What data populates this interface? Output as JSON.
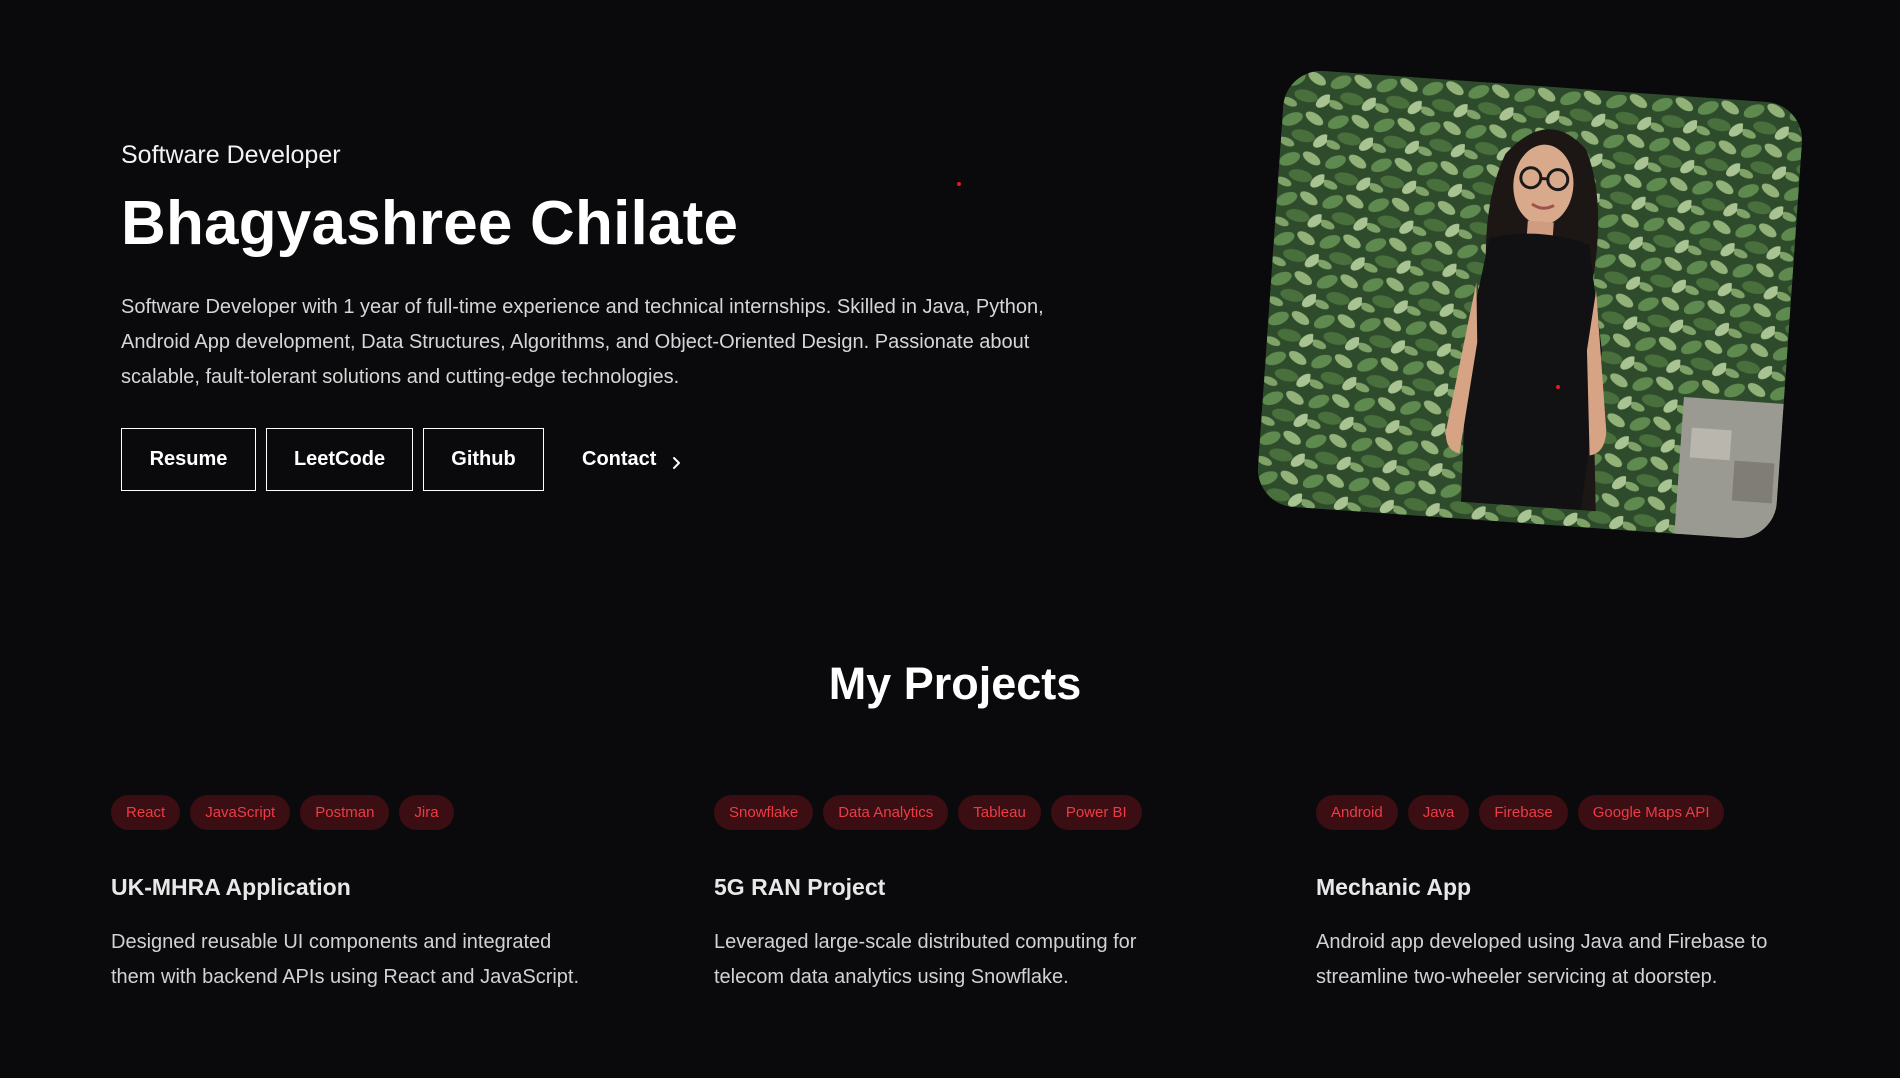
{
  "hero": {
    "subtitle": "Software Developer",
    "name": "Bhagyashree Chilate",
    "summary": "Software Developer with 1 year of full-time experience and technical internships. Skilled in Java, Python, Android App development, Data Structures, Algorithms, and Object-Oriented Design. Passionate about scalable, fault-tolerant solutions and cutting-edge technologies.",
    "buttons": {
      "resume": "Resume",
      "leetcode": "LeetCode",
      "github": "Github",
      "contact": "Contact"
    }
  },
  "photo": {
    "alt_icon": "profile-photo"
  },
  "projects": {
    "title": "My Projects",
    "items": [
      {
        "tags": [
          "React",
          "JavaScript",
          "Postman",
          "Jira"
        ],
        "title": "UK-MHRA Application",
        "description": "Designed reusable UI components and integrated them with backend APIs using React and JavaScript."
      },
      {
        "tags": [
          "Snowflake",
          "Data Analytics",
          "Tableau",
          "Power BI"
        ],
        "title": "5G RAN Project",
        "description": "Leveraged large-scale distributed computing for telecom data analytics using Snowflake."
      },
      {
        "tags": [
          "Android",
          "Java",
          "Firebase",
          "Google Maps API"
        ],
        "title": "Mechanic App",
        "description": "Android app developed using Java and Firebase to streamline two-wheeler servicing at doorstep."
      }
    ]
  },
  "colors": {
    "background": "#0a0a0c",
    "accent": "#ef3b45",
    "tag_background": "#3a0e12",
    "text": "#ffffff"
  }
}
